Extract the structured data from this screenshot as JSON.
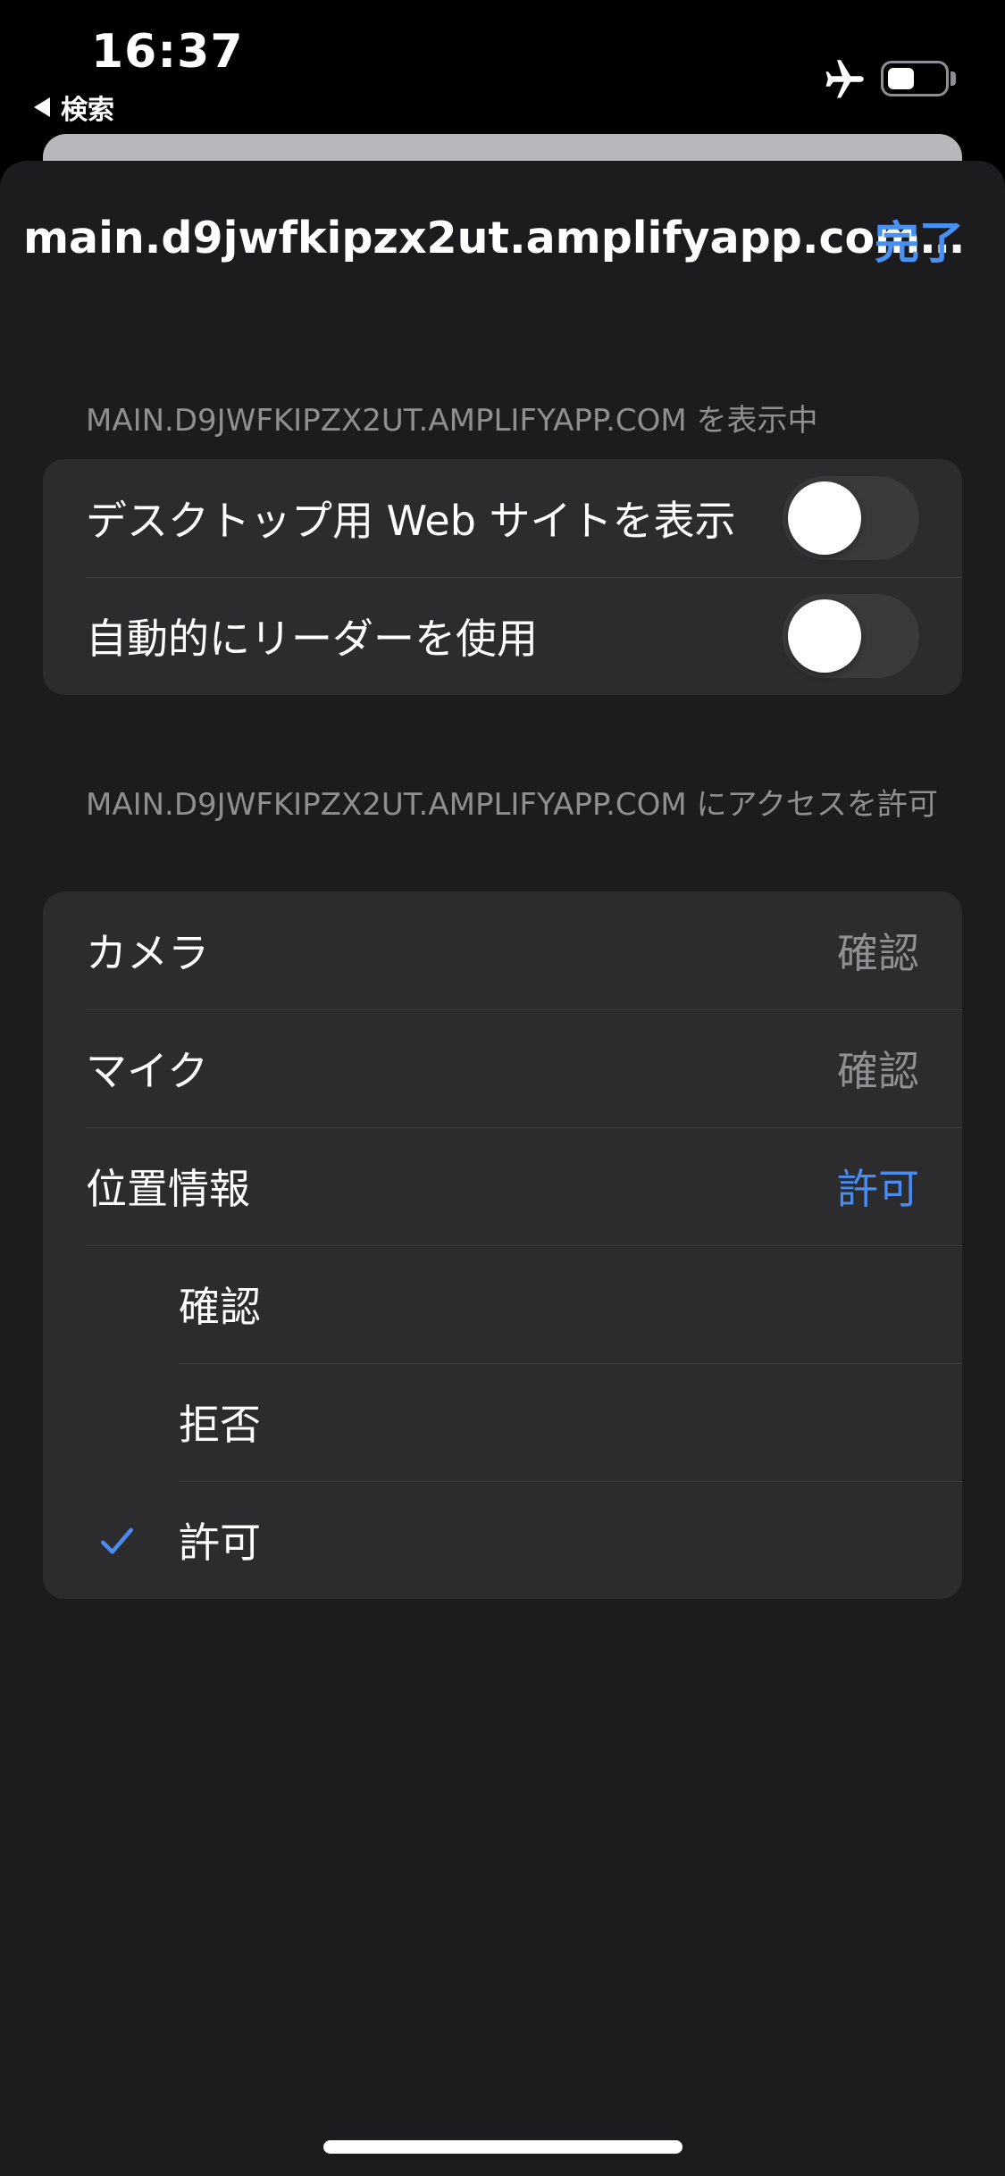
{
  "status_bar": {
    "time": "16:37",
    "back_app_label": "検索",
    "airplane_icon": "airplane-icon",
    "battery_icon": "battery-icon",
    "battery_level": 0.45
  },
  "nav": {
    "title": "main.d9jwfkipzx2ut.amplifyapp.com…",
    "done_label": "完了"
  },
  "display_section": {
    "header": "MAIN.D9JWFKIPZX2UT.AMPLIFYAPP.COM を表示中",
    "rows": [
      {
        "label": "デスクトップ用 Web サイトを表示",
        "toggle_on": false
      },
      {
        "label": "自動的にリーダーを使用",
        "toggle_on": false
      }
    ]
  },
  "access_section": {
    "header": "MAIN.D9JWFKIPZX2UT.AMPLIFYAPP.COM にアクセスを許可",
    "rows": [
      {
        "label": "カメラ",
        "value": "確認"
      },
      {
        "label": "マイク",
        "value": "確認"
      },
      {
        "label": "位置情報",
        "value": "許可"
      }
    ],
    "location_options": [
      {
        "label": "確認",
        "selected": false
      },
      {
        "label": "拒否",
        "selected": false
      },
      {
        "label": "許可",
        "selected": true
      }
    ]
  },
  "colors": {
    "accent": "#4a8cf0",
    "sheet_background": "#1c1c1e",
    "cell_background": "#2c2c2e",
    "secondary_text": "#8e8e93"
  }
}
